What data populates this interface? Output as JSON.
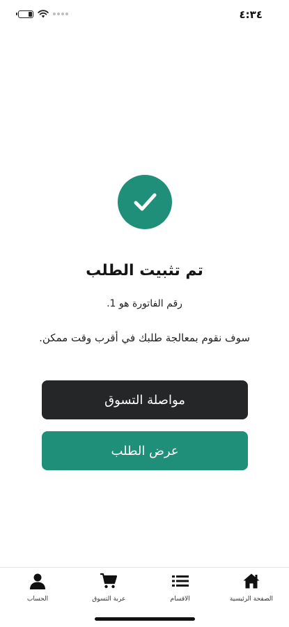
{
  "status_bar": {
    "time": "٤:٣٤",
    "battery_icon": "battery-icon",
    "wifi_icon": "wifi-icon",
    "signal_icon": "signal-dots-icon"
  },
  "confirmation": {
    "icon": "check-icon",
    "accent_color": "#1f8f7a",
    "title": "تم تثبيت الطلب",
    "invoice_text": "رقم الفاتورة هو 1.",
    "message": "سوف نقوم بمعالجة طلبك في أقرب وقت ممكن."
  },
  "buttons": {
    "continue_shopping": "مواصلة التسوق",
    "continue_color": "#252628",
    "view_order": "عرض الطلب",
    "view_color": "#1f8f7a"
  },
  "bottom_nav": {
    "items": [
      {
        "label": "الصفحة الرئيسية",
        "icon": "home-icon"
      },
      {
        "label": "الاقسام",
        "icon": "list-icon"
      },
      {
        "label": "عربة التسوق",
        "icon": "cart-icon"
      },
      {
        "label": "الحساب",
        "icon": "user-icon"
      }
    ]
  }
}
